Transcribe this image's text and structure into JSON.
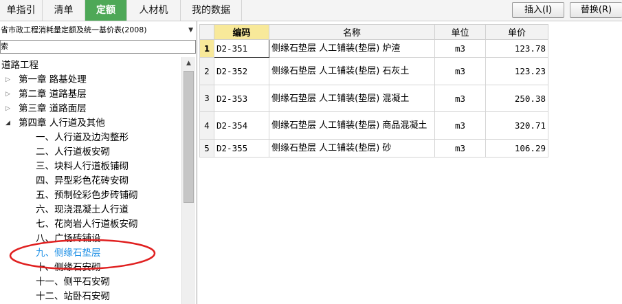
{
  "tabs": [
    {
      "label": "单指引",
      "active": false
    },
    {
      "label": "清单",
      "active": false
    },
    {
      "label": "定额",
      "active": true
    },
    {
      "label": "人材机",
      "active": false
    },
    {
      "label": "我的数据",
      "active": false
    }
  ],
  "toolbar": {
    "insert_label": "插入(I)",
    "replace_label": "替换(R)"
  },
  "library": {
    "selected": "省市政工程消耗量定额及统一基价表(2008)"
  },
  "search": {
    "value": "索"
  },
  "tree": {
    "root": "道路工程",
    "chapters": [
      "第一章  路基处理",
      "第二章   道路基层",
      "第三章  道路面层",
      "第四章  人行道及其他"
    ],
    "sections": [
      "一、人行道及边沟整形",
      "二、人行道板安砌",
      "三、块料人行道板铺砌",
      "四、异型彩色花砖安砌",
      "五、预制砼彩色步砖铺砌",
      "六、现浇混凝土人行道",
      "七、花岗岩人行道板安砌",
      "八、广场砖铺设",
      "九、侧缘石垫层",
      "十、侧缘石安砌",
      "十一、侧平石安砌",
      "十二、站卧石安砌"
    ]
  },
  "grid": {
    "headers": {
      "code": "编码",
      "name": "名称",
      "unit": "单位",
      "price": "单价"
    },
    "rows": [
      {
        "no": "1",
        "code": "D2-351",
        "name": "侧缘石垫层 人工铺装(垫层) 炉渣",
        "unit": "m3",
        "price": "123.78"
      },
      {
        "no": "2",
        "code": "D2-352",
        "name": "侧缘石垫层 人工铺装(垫层) 石灰土",
        "unit": "m3",
        "price": "123.23"
      },
      {
        "no": "3",
        "code": "D2-353",
        "name": "侧缘石垫层 人工铺装(垫层) 混凝土",
        "unit": "m3",
        "price": "250.38"
      },
      {
        "no": "4",
        "code": "D2-354",
        "name": "侧缘石垫层 人工铺装(垫层) 商品混凝土",
        "unit": "m3",
        "price": "320.71"
      },
      {
        "no": "5",
        "code": "D2-355",
        "name": "侧缘石垫层 人工铺装(垫层) 砂",
        "unit": "m3",
        "price": "106.29"
      }
    ]
  },
  "colors": {
    "tab_active": "#4ea857",
    "header_highlight": "#f8e99a",
    "selected_text": "#1e90e6",
    "annotation": "#e02020"
  }
}
